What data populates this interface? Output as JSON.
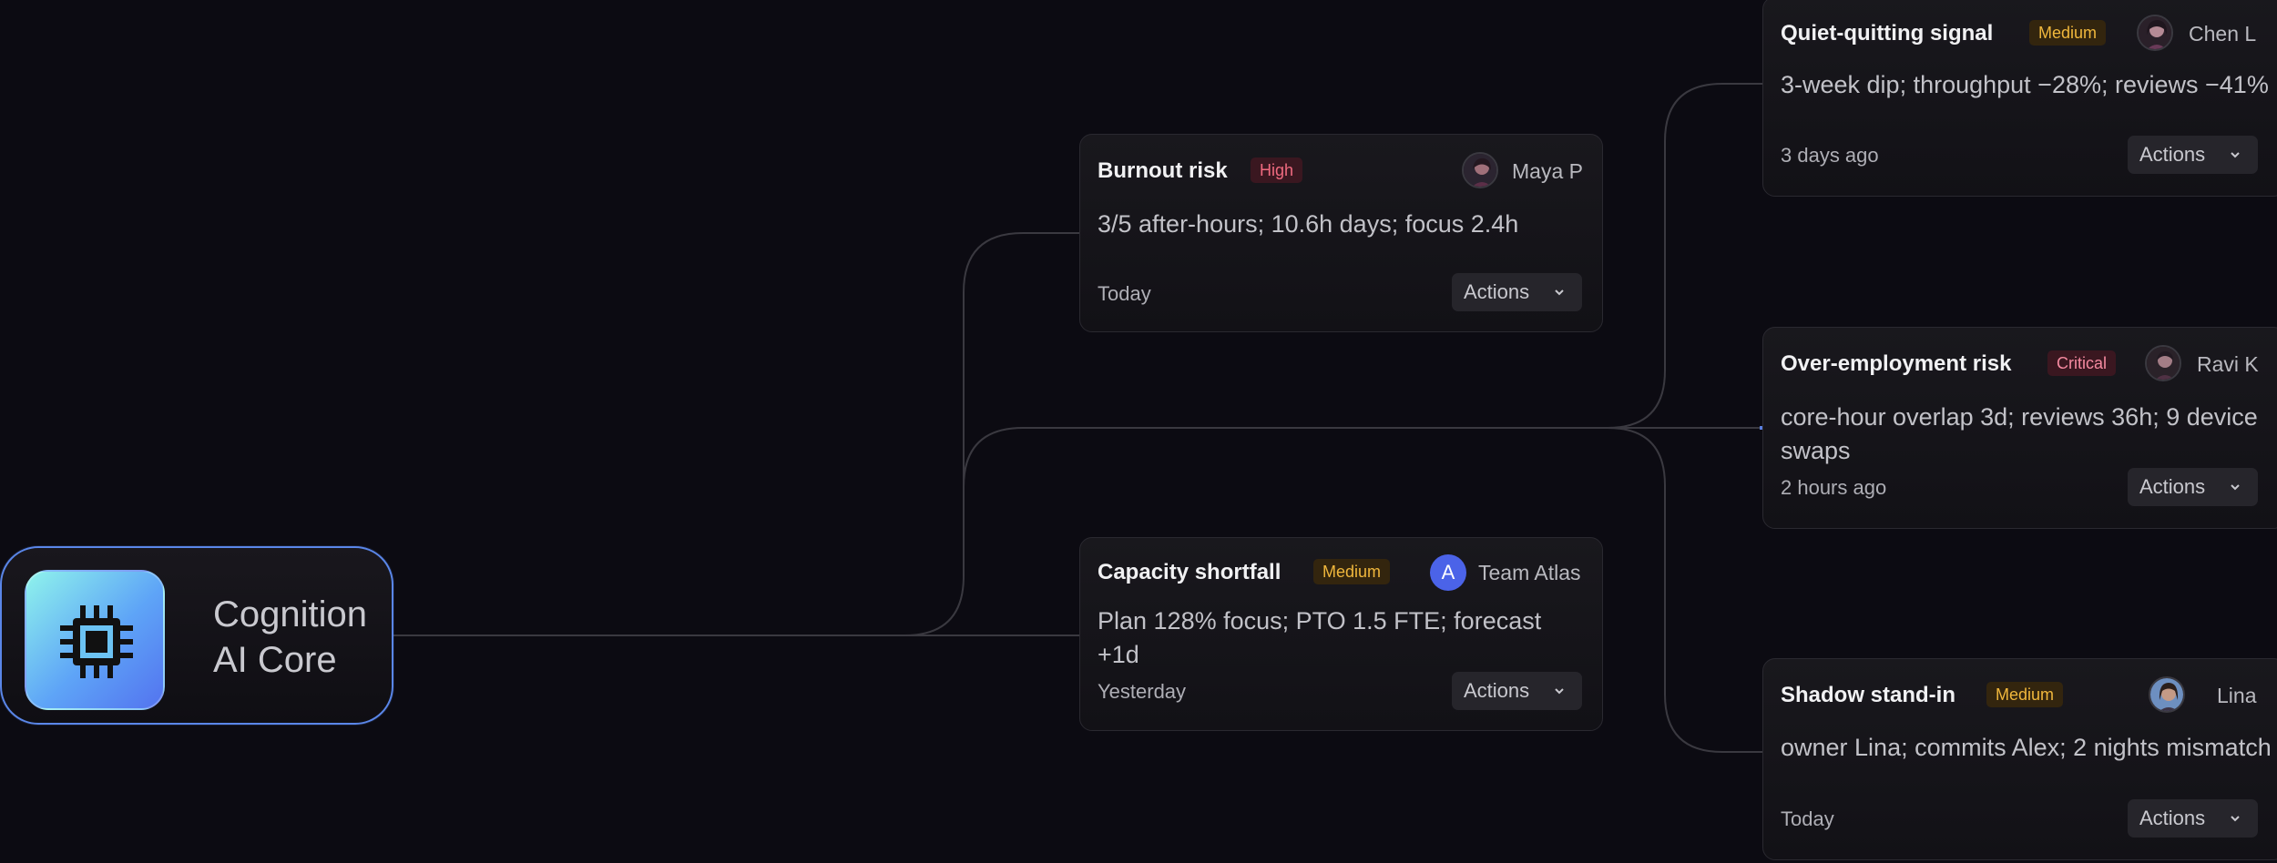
{
  "core": {
    "title_line1": "Cognition",
    "title_line2": "AI Core",
    "icon": "cpu-chip-icon"
  },
  "cards": {
    "burnout": {
      "title": "Burnout risk",
      "severity": "High",
      "assignee": "Maya P",
      "description": "3/5 after-hours; 10.6h days; focus 2.4h",
      "time": "Today",
      "actions_label": "Actions"
    },
    "capacity": {
      "title": "Capacity shortfall",
      "severity": "Medium",
      "assignee_initial": "A",
      "assignee": "Team Atlas",
      "description": "Plan 128% focus; PTO 1.5 FTE; forecast +1d",
      "time": "Yesterday",
      "actions_label": "Actions"
    },
    "quiet": {
      "title": "Quiet-quitting signal",
      "severity": "Medium",
      "assignee": "Chen L",
      "description": "3-week dip; throughput −28%; reviews −41%",
      "time": "3 days ago",
      "actions_label": "Actions"
    },
    "overemployment": {
      "title": "Over-employment risk",
      "severity": "Critical",
      "assignee": "Ravi K",
      "description": "core-hour overlap 3d; reviews 36h; 9 device swaps",
      "time": "2 hours ago",
      "actions_label": "Actions"
    },
    "shadow": {
      "title": "Shadow stand-in",
      "severity": "Medium",
      "assignee": "Lina",
      "description": "owner Lina; commits Alex; 2 nights mismatch",
      "time": "Today",
      "actions_label": "Actions"
    }
  },
  "colors": {
    "background": "#0c0b12",
    "connector": "#3a3940",
    "core_border": "#5a86e8",
    "badge_high": "#f06b80",
    "badge_medium": "#f0b73c",
    "badge_critical": "#f58aa0"
  }
}
